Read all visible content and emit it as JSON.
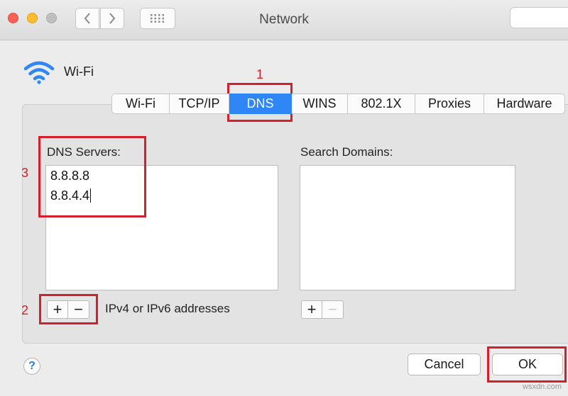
{
  "window": {
    "title": "Network",
    "grid_icon": "grid-icon",
    "back_icon": "chevron-left-icon",
    "forward_icon": "chevron-right-icon"
  },
  "header": {
    "interface_name": "Wi-Fi",
    "icon": "wifi-icon",
    "accent": "#2f86f5"
  },
  "tabs": [
    {
      "label": "Wi-Fi",
      "active": false
    },
    {
      "label": "TCP/IP",
      "active": false
    },
    {
      "label": "DNS",
      "active": true
    },
    {
      "label": "WINS",
      "active": false
    },
    {
      "label": "802.1X",
      "active": false
    },
    {
      "label": "Proxies",
      "active": false
    },
    {
      "label": "Hardware",
      "active": false
    }
  ],
  "dns": {
    "label": "DNS Servers:",
    "servers": [
      "8.8.8.8",
      "8.8.4.4"
    ],
    "add_label": "+",
    "remove_label": "−",
    "hint": "IPv4 or IPv6 addresses"
  },
  "search_domains": {
    "label": "Search Domains:",
    "add_label": "+",
    "remove_label": "−"
  },
  "buttons": {
    "cancel": "Cancel",
    "ok": "OK",
    "help": "?"
  },
  "annotations": {
    "step1": "1",
    "step2": "2",
    "step3": "3",
    "color": "#d3202c"
  },
  "watermark": "wsxdn.com"
}
